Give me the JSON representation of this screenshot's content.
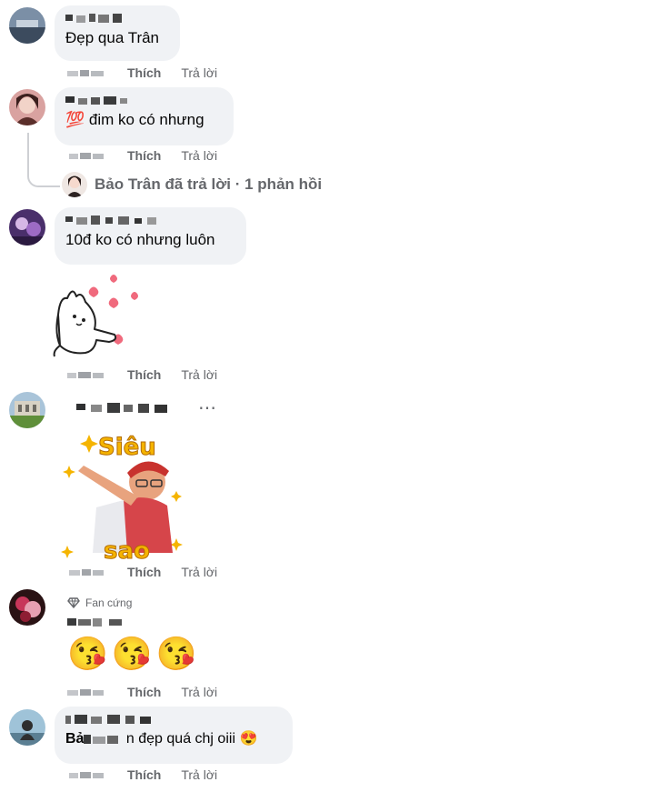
{
  "actions": {
    "like_label": "Thích",
    "reply_label": "Trả lời"
  },
  "comments": [
    {
      "text": "Đẹp qua Trân"
    },
    {
      "emoji": "💯",
      "text": "đim ko có nhưng"
    },
    {
      "text": "10đ ko có nhưng luôn"
    },
    {
      "text": ""
    },
    {
      "badge": "Fan cứng",
      "emoji_row": [
        "😘",
        "😘",
        "😘"
      ]
    },
    {
      "name_visible": "Bả",
      "text": "n đẹp quá chj oiii",
      "emoji": "😍"
    }
  ],
  "reply_summary": {
    "text": "Bảo Trân đã trả lời · 1 phản hồi"
  },
  "sticker_superstar": {
    "line1": "Siêu",
    "line2": "sao"
  },
  "more_icon": "⋯",
  "colors": {
    "bubble": "#f0f2f5",
    "secondary_text": "#65676b",
    "sticker_text": "#f5b400"
  }
}
